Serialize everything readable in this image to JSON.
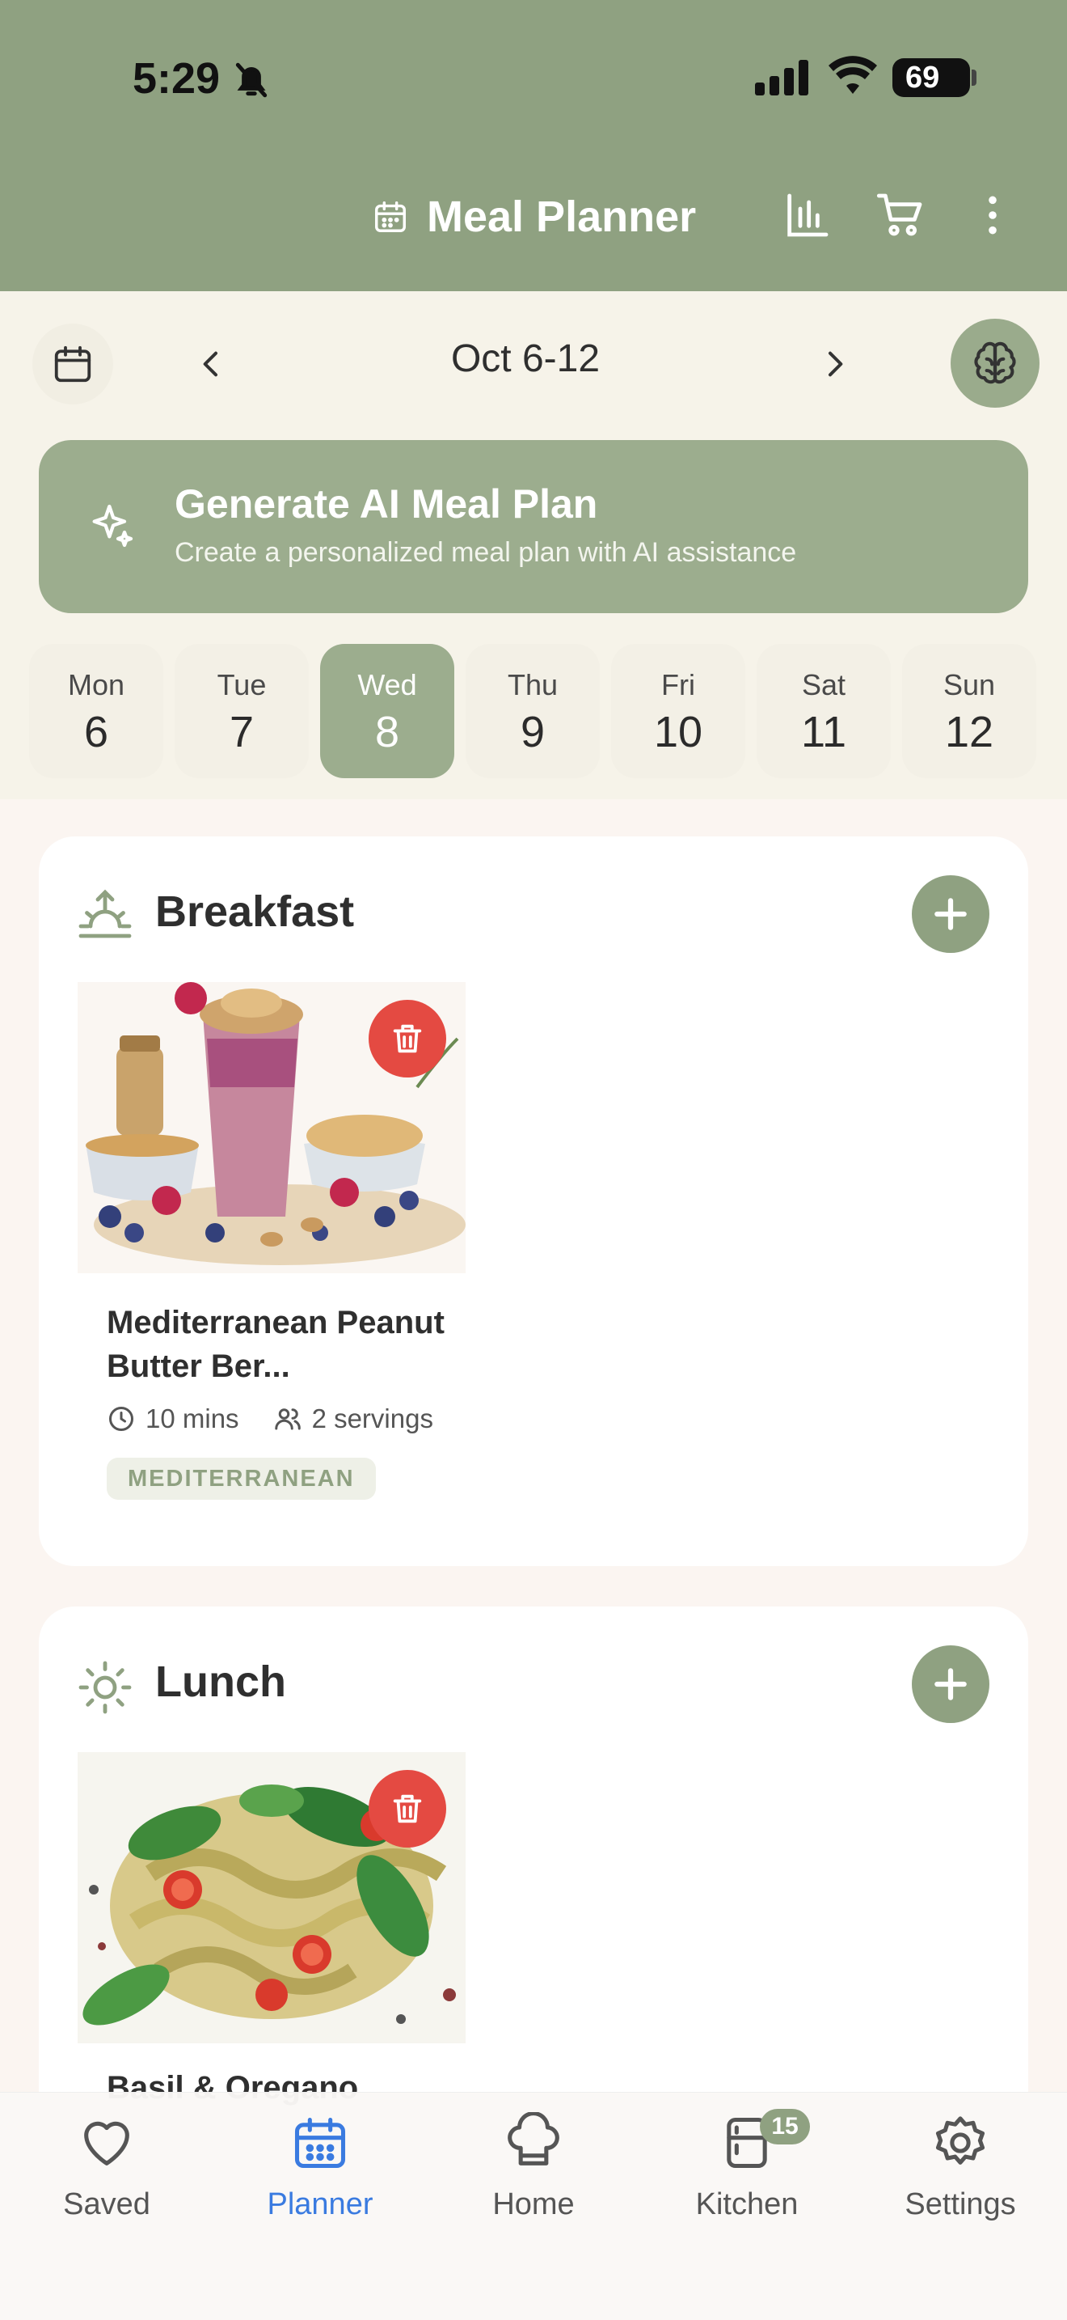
{
  "status_bar": {
    "time": "5:29",
    "battery": "69"
  },
  "header": {
    "title": "Meal Planner",
    "icons": [
      "calendar-icon",
      "chart-icon",
      "cart-icon",
      "more-icon"
    ]
  },
  "week": {
    "label": "Oct 6-12",
    "days": [
      {
        "name": "Mon",
        "num": "6"
      },
      {
        "name": "Tue",
        "num": "7"
      },
      {
        "name": "Wed",
        "num": "8"
      },
      {
        "name": "Thu",
        "num": "9"
      },
      {
        "name": "Fri",
        "num": "10"
      },
      {
        "name": "Sat",
        "num": "11"
      },
      {
        "name": "Sun",
        "num": "12"
      }
    ],
    "selected": "Wed"
  },
  "ai_banner": {
    "title": "Generate AI Meal Plan",
    "subtitle": "Create a personalized meal plan with AI assistance"
  },
  "meals": {
    "breakfast": {
      "title": "Breakfast",
      "recipe": {
        "name": "Mediterranean Peanut Butter Ber...",
        "time": "10 mins",
        "servings": "2 servings",
        "tag": "MEDITERRANEAN"
      }
    },
    "lunch": {
      "title": "Lunch",
      "recipe": {
        "name": "Basil & Oregano"
      }
    }
  },
  "tabbar": {
    "items": [
      {
        "label": "Saved",
        "icon": "heart-icon"
      },
      {
        "label": "Planner",
        "icon": "calendar-icon"
      },
      {
        "label": "Home",
        "icon": "chef-hat-icon"
      },
      {
        "label": "Kitchen",
        "icon": "fridge-icon",
        "badge": "15"
      },
      {
        "label": "Settings",
        "icon": "gear-icon"
      }
    ],
    "active": "Planner"
  },
  "colors": {
    "primary": "#8fa181",
    "banner": "#9cad8e",
    "delete": "#e44a42",
    "active_tab": "#3a7be0"
  }
}
